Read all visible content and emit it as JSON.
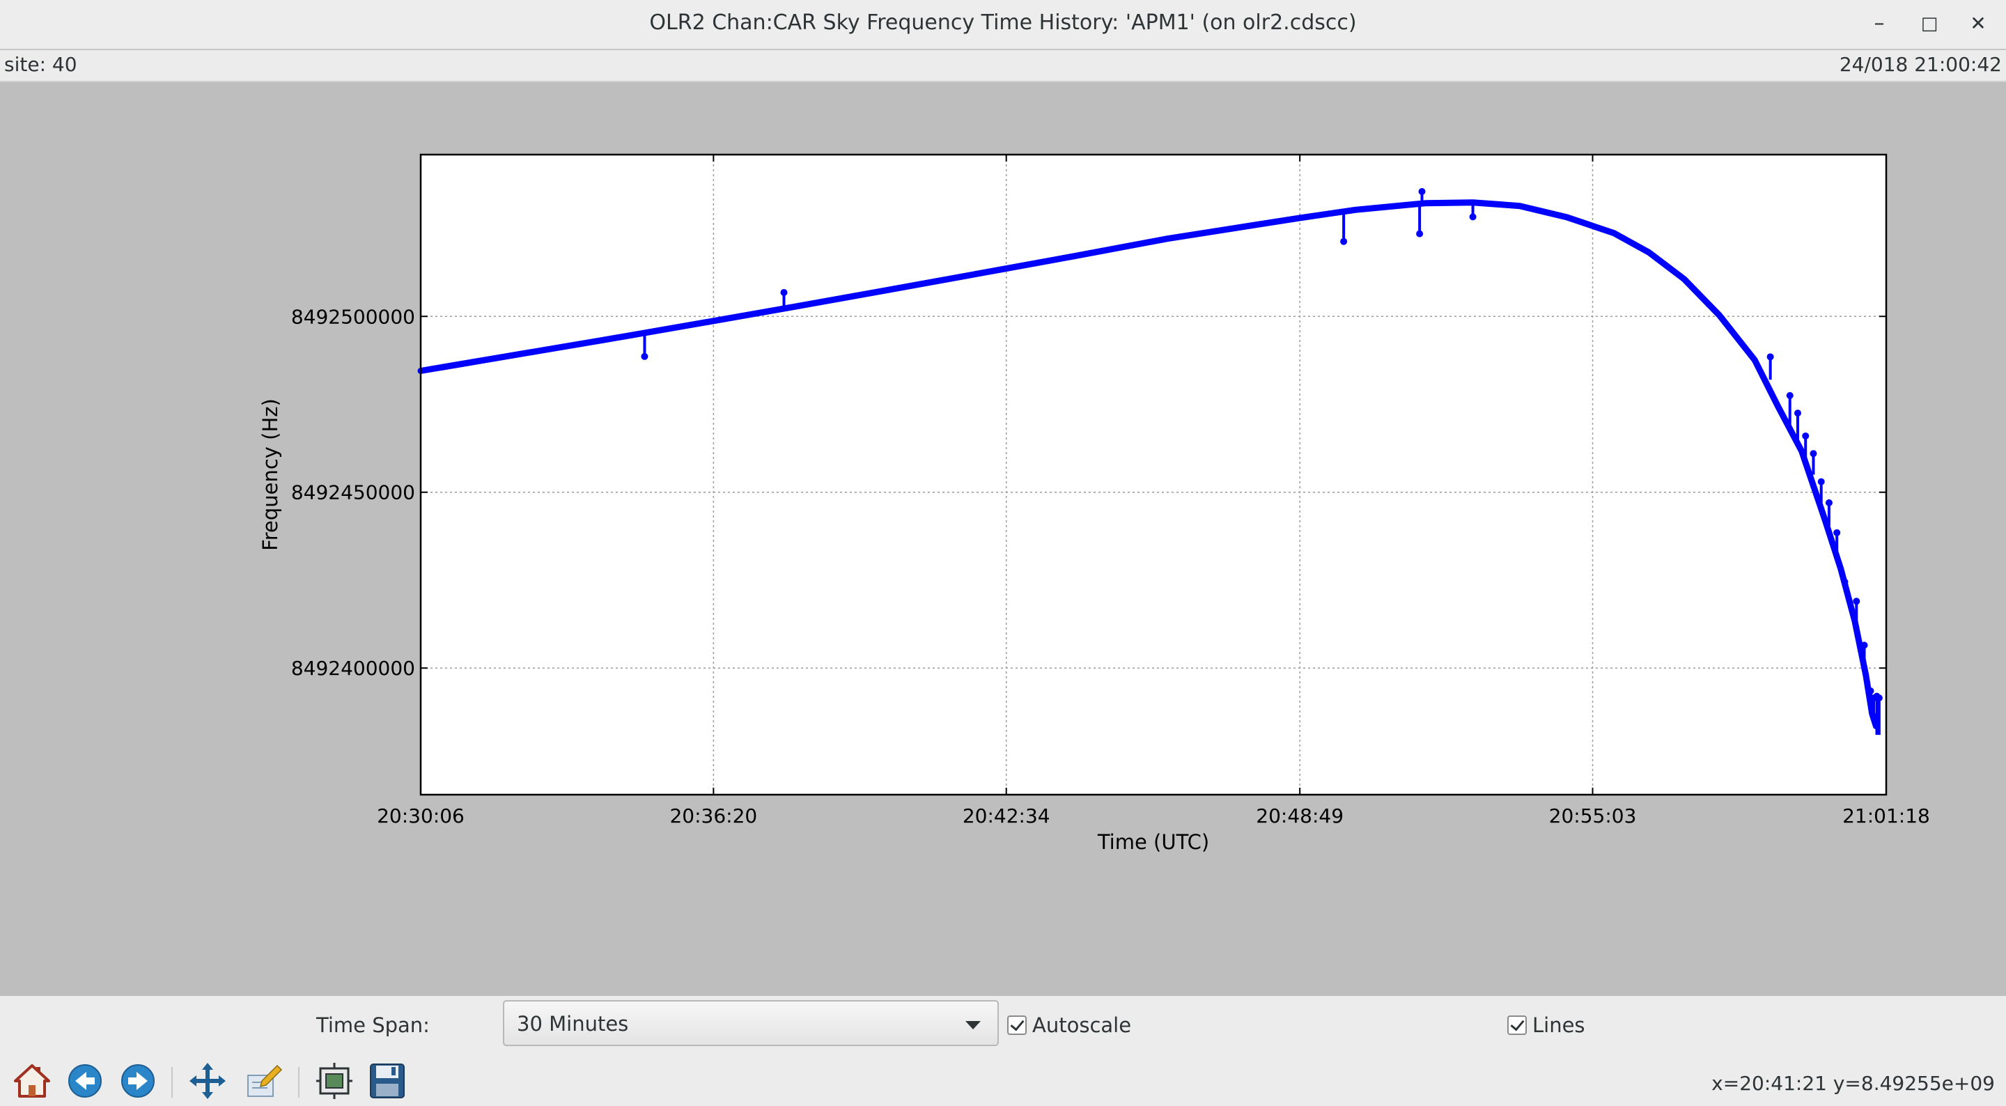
{
  "window": {
    "title": "OLR2 Chan:CAR  Sky Frequency Time History: 'APM1' (on olr2.cdscc)",
    "minimize_label": "–",
    "maximize_label": "□",
    "close_label": "✕"
  },
  "infobar": {
    "site": "site: 40",
    "timestamp": "24/018 21:00:42"
  },
  "chart_data": {
    "type": "line",
    "title": "",
    "xlabel": "Time (UTC)",
    "ylabel": "Frequency (Hz)",
    "x_tick_labels": [
      "20:30:06",
      "20:36:20",
      "20:42:34",
      "20:48:49",
      "20:55:03",
      "21:01:18"
    ],
    "x_tick_values": [
      "20:30:06",
      "20:36:20",
      "20:42:34",
      "20:48:49",
      "20:55:03",
      "21:01:18"
    ],
    "xlim": [
      "20:30:06",
      "21:01:18"
    ],
    "y_tick_values": [
      8492400000,
      8492450000,
      8492500000
    ],
    "y_tick_labels": [
      "8492400000",
      "8492450000",
      "8492500000"
    ],
    "ylim": [
      8492364000,
      8492546000
    ],
    "grid": true,
    "series": [
      {
        "color": "#0000ff",
        "points": [
          [
            "20:30:06",
            8492484500
          ],
          [
            "20:32:00",
            8492488800
          ],
          [
            "20:34:00",
            8492493300
          ],
          [
            "20:36:20",
            8492498700
          ],
          [
            "20:38:00",
            8492502600
          ],
          [
            "20:40:00",
            8492507400
          ],
          [
            "20:42:34",
            8492513600
          ],
          [
            "20:44:00",
            8492517100
          ],
          [
            "20:46:00",
            8492522100
          ],
          [
            "20:48:49",
            8492528000
          ],
          [
            "20:50:00",
            8492530300
          ],
          [
            "20:51:30",
            8492532200
          ],
          [
            "20:52:30",
            8492532400
          ],
          [
            "20:53:30",
            8492531400
          ],
          [
            "20:54:30",
            8492528200
          ],
          [
            "20:55:30",
            8492523700
          ],
          [
            "20:56:15",
            8492518200
          ],
          [
            "20:57:00",
            8492510600
          ],
          [
            "20:57:45",
            8492500300
          ],
          [
            "20:58:30",
            8492487600
          ],
          [
            "20:59:00",
            8492474300
          ],
          [
            "20:59:30",
            8492461700
          ],
          [
            "21:00:00",
            8492442000
          ],
          [
            "21:00:20",
            8492428200
          ],
          [
            "21:00:38",
            8492413300
          ],
          [
            "21:00:52",
            8492398000
          ],
          [
            "21:01:00",
            8492387000
          ],
          [
            "21:01:05",
            8492383500
          ]
        ],
        "spikes": [
          [
            "20:34:52",
            8492494700,
            8492488600
          ],
          [
            "20:37:50",
            8492502200,
            8492506800
          ],
          [
            "20:49:45",
            8492529700,
            8492521300
          ],
          [
            "20:51:22",
            8492532000,
            8492523500
          ],
          [
            "20:51:25",
            8492532000,
            8492535500
          ],
          [
            "20:52:30",
            8492532400,
            8492528300
          ],
          [
            "20:58:50",
            8492482000,
            8492488500
          ],
          [
            "20:59:15",
            8492468500,
            8492477500
          ],
          [
            "20:59:25",
            8492465000,
            8492472500
          ],
          [
            "20:59:35",
            8492459500,
            8492466000
          ],
          [
            "20:59:45",
            8492455000,
            8492461000
          ],
          [
            "20:59:55",
            8492447000,
            8492453000
          ],
          [
            "21:00:05",
            8492440500,
            8492447000
          ],
          [
            "21:00:15",
            8492432000,
            8492438500
          ],
          [
            "21:00:25",
            8492425000,
            8492424500
          ],
          [
            "21:00:40",
            8492413000,
            8492419000
          ],
          [
            "21:00:50",
            8492401000,
            8492406500
          ],
          [
            "21:00:58",
            8492390000,
            8492393500
          ],
          [
            "21:01:02",
            8492384000,
            8492391500
          ],
          [
            "21:01:06",
            8492381000,
            8492392000
          ],
          [
            "21:01:09",
            8492381000,
            8492391500
          ]
        ]
      }
    ]
  },
  "controls": {
    "time_span_label": "Time Span:",
    "time_span_value": "30 Minutes",
    "autoscale_label": "Autoscale",
    "autoscale_checked": true,
    "lines_label": "Lines",
    "lines_checked": true
  },
  "toolbar": {
    "icons": [
      "home-icon",
      "back-arrow-icon",
      "forward-arrow-icon",
      "pan-icon",
      "edit-axes-icon",
      "configure-subplots-icon",
      "save-icon"
    ]
  },
  "status": {
    "coords": "x=20:41:21 y=8.49255e+09"
  }
}
